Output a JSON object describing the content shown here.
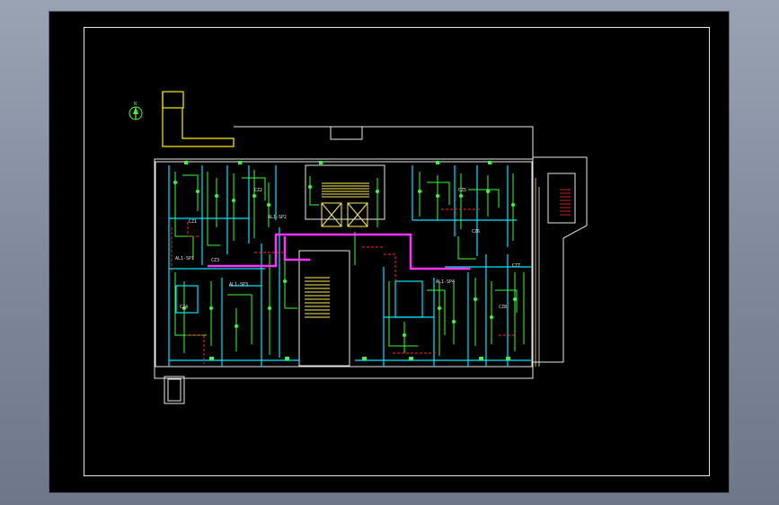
{
  "drawing": {
    "north_arrow_label": "N",
    "room_labels": [
      "CZ1",
      "CZ2",
      "CZ3",
      "CZ4",
      "CZ5",
      "CZ6",
      "CZ7",
      "CZ8"
    ],
    "panel_labels": [
      "AL1-SP1",
      "AL1-SP2",
      "AL1-SP3",
      "AL1-SP4"
    ],
    "colors": {
      "background": "#000000",
      "walls": "#e8e8e8",
      "wiring_cyan": "#00e5ff",
      "wiring_green": "#33ff33",
      "main_trunk_magenta": "#ff33ff",
      "dashed_red": "#ff2a2a",
      "highlight_yellow": "#ffee00",
      "stair_yellow": "#ffee55"
    }
  }
}
